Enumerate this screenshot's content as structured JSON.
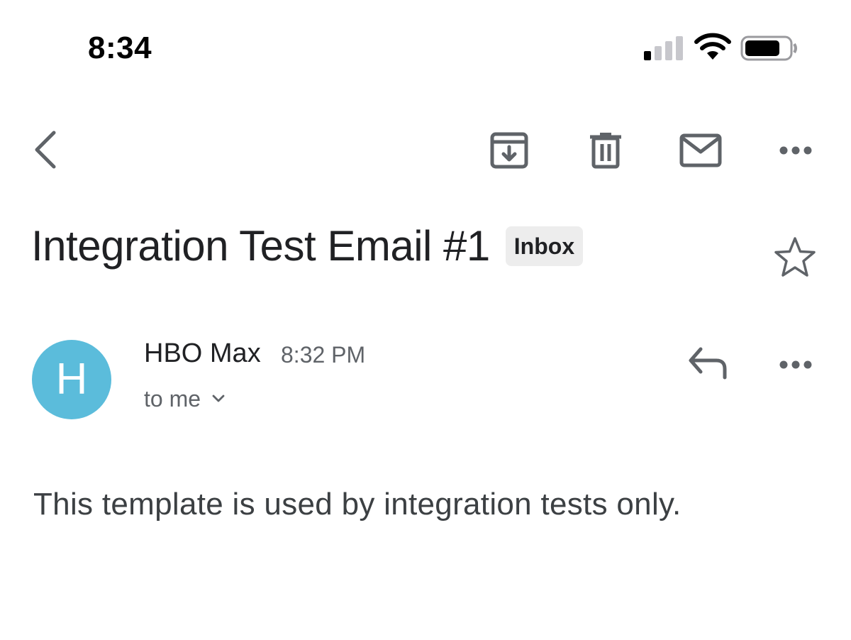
{
  "status_bar": {
    "time": "8:34",
    "icons": [
      "cellular-signal-icon",
      "wifi-icon",
      "battery-icon"
    ]
  },
  "toolbar": {
    "icons": [
      "back-arrow-icon",
      "archive-icon",
      "trash-icon",
      "mail-icon",
      "more-horizontal-icon"
    ]
  },
  "email": {
    "subject": "Integration Test Email #1",
    "label": "Inbox",
    "sender": {
      "avatar_letter": "H",
      "avatar_color": "#5bbcdb",
      "name": "HBO Max",
      "time": "8:32 PM",
      "recipient": "to me"
    },
    "body": "This template is used by integration tests only."
  },
  "colors": {
    "icon_gray": "#5f6368",
    "badge_bg": "#ededed",
    "text_primary": "#202124"
  }
}
